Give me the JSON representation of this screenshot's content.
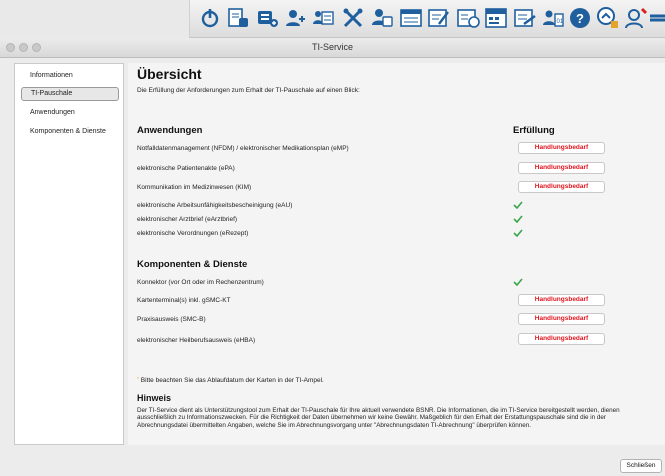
{
  "window": {
    "title": "TI-Service",
    "close_label": "Schließen"
  },
  "toolbar": {
    "icons": [
      "power-icon",
      "pending-docs-icon",
      "contacts-add-icon",
      "user-add-icon",
      "list-card-icon",
      "tools-icon",
      "ehealth-icon",
      "calendar-list-icon",
      "note-pen-icon",
      "schedule-icon",
      "keyboard-icon",
      "edit-list-icon",
      "user-group-icon",
      "help-icon"
    ]
  },
  "sidebar": {
    "items": [
      {
        "label": "Informationen",
        "active": false
      },
      {
        "label": "TI-Pauschale",
        "active": true
      },
      {
        "label": "Anwendungen",
        "active": false
      },
      {
        "label": "Komponenten & Dienste",
        "active": false
      }
    ]
  },
  "main": {
    "title": "Übersicht",
    "intro": "Die Erfüllung der Anforderungen zum Erhalt der TI-Pauschale auf einen Blick:",
    "fulfillment_header": "Erfüllung",
    "sections": [
      {
        "title": "Anwendungen",
        "rows": [
          {
            "label": "Notfalldatenmanagement (NFDM) / elektronischer Medikationsplan (eMP)",
            "status": "Handlungsbedarf"
          },
          {
            "label": "elektronische Patientenakte (ePA)",
            "status": "Handlungsbedarf"
          },
          {
            "label": "Kommunikation im Medizinwesen (KIM)",
            "status": "Handlungsbedarf"
          },
          {
            "label": "elektronische Arbeitsunfähigkeitsbescheinigung (eAU)",
            "status": "ok"
          },
          {
            "label": "elektronischer Arztbrief (eArztbrief)",
            "status": "ok"
          },
          {
            "label": "elektronische Verordnungen (eRezept)",
            "status": "ok"
          }
        ]
      },
      {
        "title": "Komponenten & Dienste",
        "rows": [
          {
            "label": "Konnektor (vor Ort oder im Rechenzentrum)",
            "status": "ok"
          },
          {
            "label": "Kartenterminal(s) inkl. gSMC-KT",
            "status": "Handlungsbedarf"
          },
          {
            "label": "Praxisausweis (SMC-B)",
            "status": "Handlungsbedarf"
          },
          {
            "label": "elektronischer Heilberufsausweis (eHBA)",
            "status": "Handlungsbedarf"
          }
        ]
      }
    ],
    "note_star": "*",
    "note": "Bitte beachten Sie das Ablaufdatum der Karten in der TI-Ampel.",
    "hint_title": "Hinweis",
    "hint_text": "Der TI-Service dient als Unterstützungstool zum Erhalt der TI-Pauschale für Ihre aktuell verwendete BSNR. Die Informationen, die im TI-Service bereitgestellt werden, dienen ausschließlich zu Informationszwecken. Für die Richtigkeit der Daten übernehmen wir keine Gewähr. Maßgeblich für den Erhalt der Erstattungspauschale sind die in der Abrechnungsdatei übermittelten Angaben, welche Sie im Abrechnungsvorgang unter \"Abrechnungsdaten TI-Abrechnung\" überprüfen können."
  },
  "colors": {
    "action_needed": "#e0141e",
    "ok": "#3aa64a",
    "accent_icon": "#1f5f9e"
  }
}
